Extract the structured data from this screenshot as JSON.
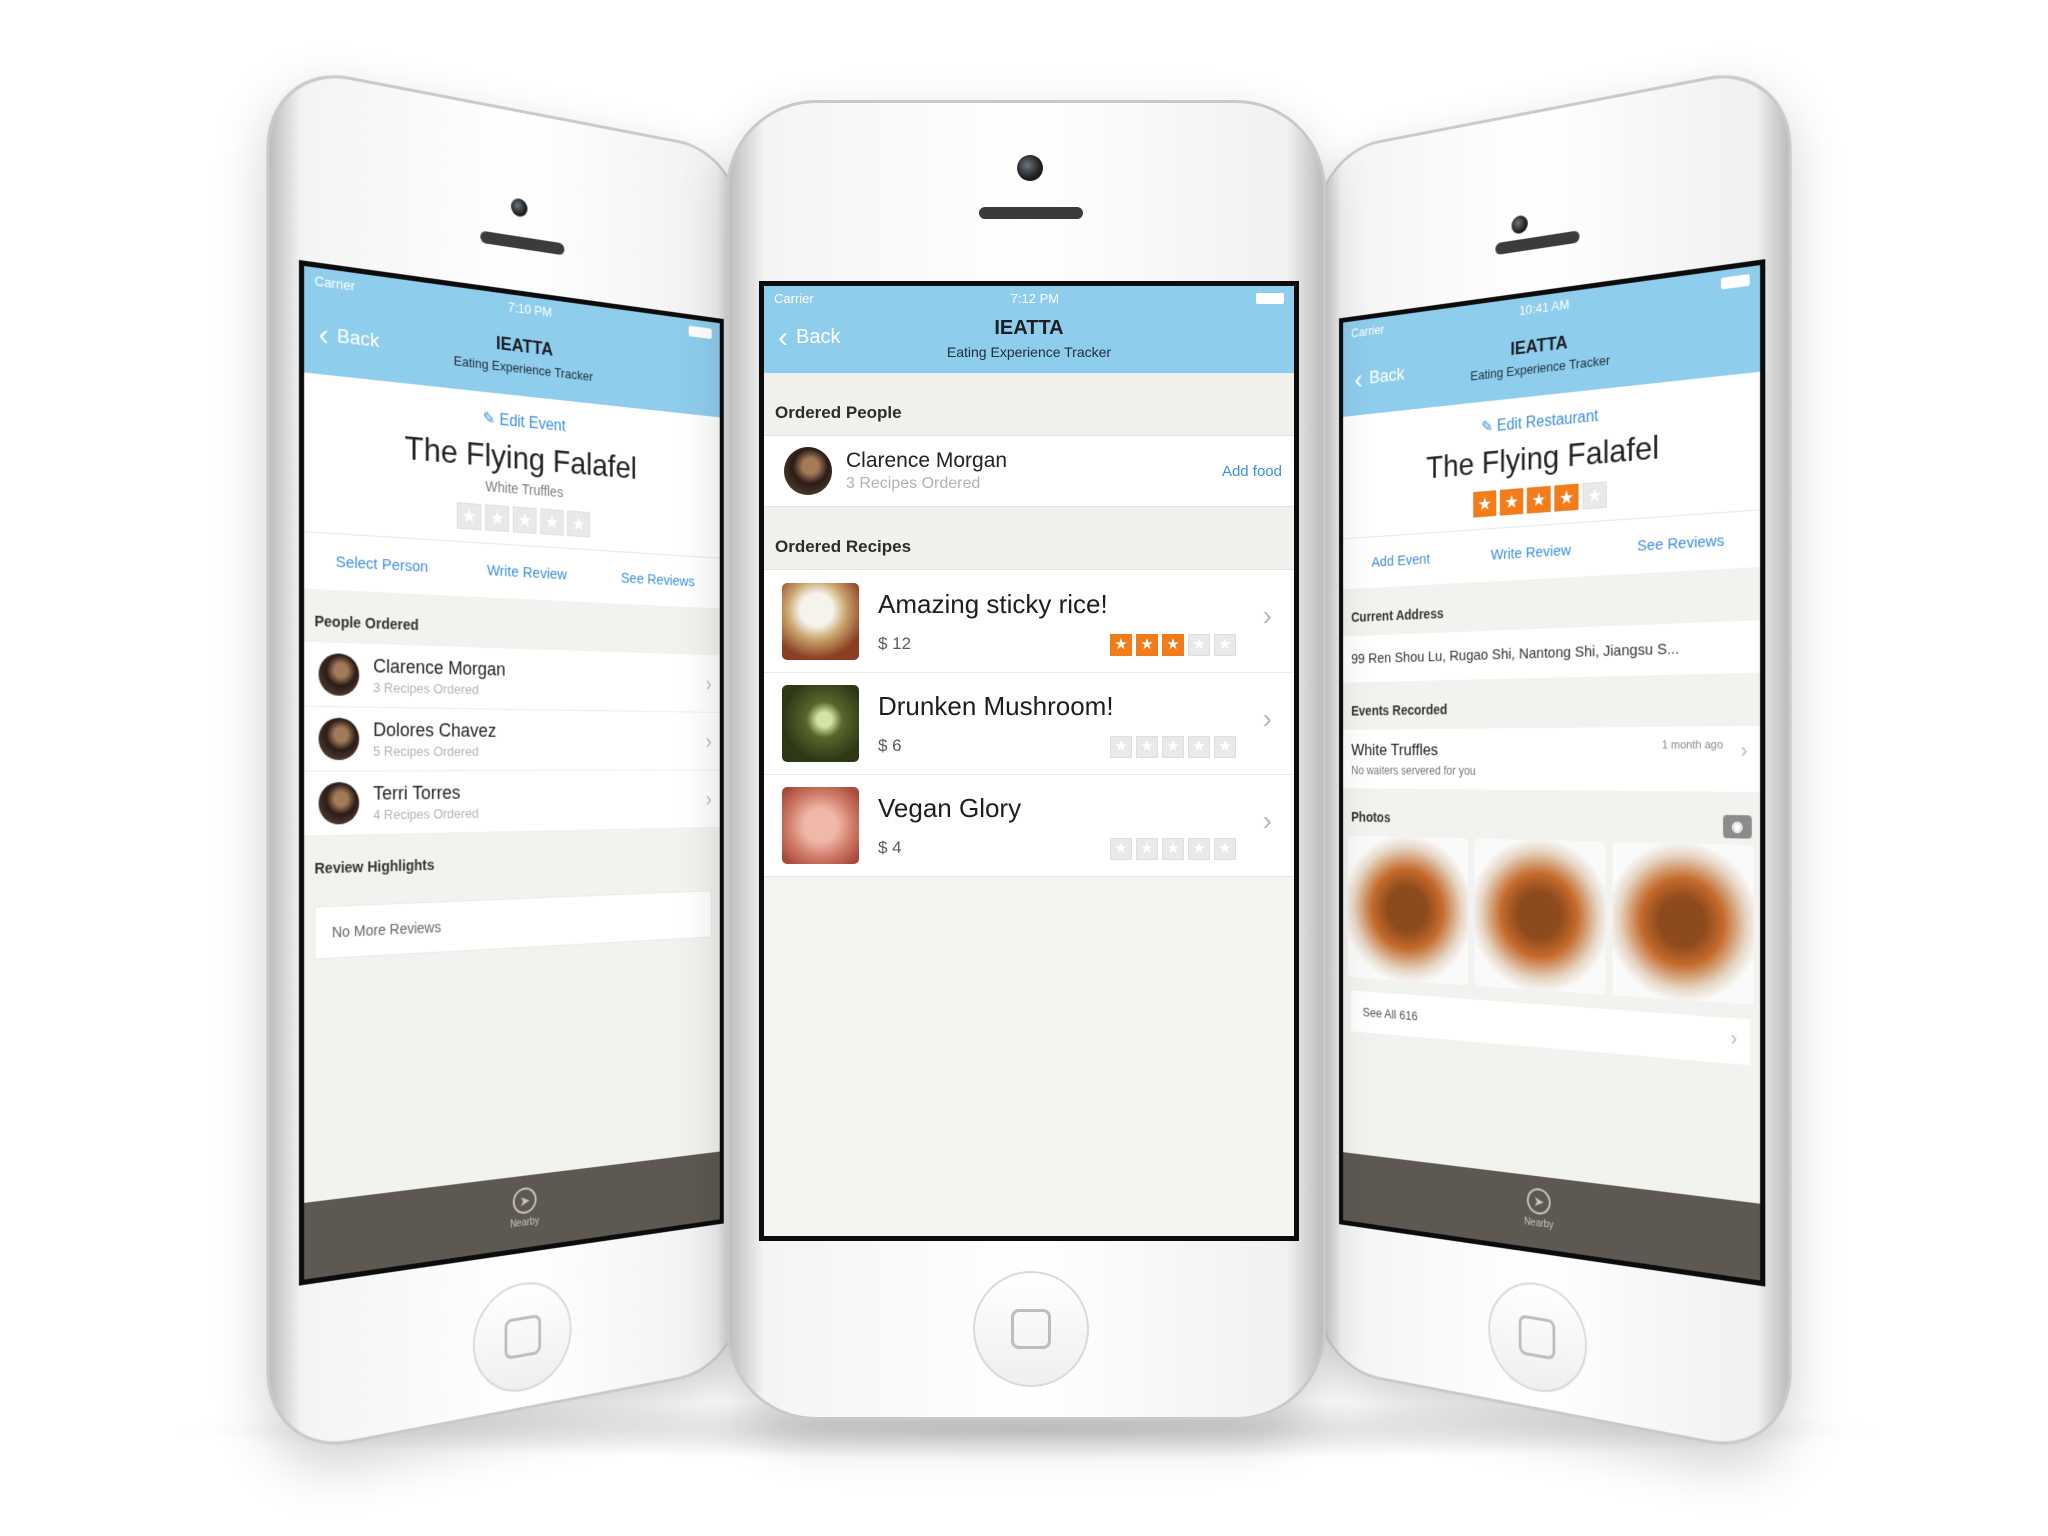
{
  "app": {
    "name": "IEATTA",
    "subtitle": "Eating Experience Tracker",
    "back_label": "Back",
    "colors": {
      "nav": "#8fcded",
      "accent": "#3e8fdf",
      "star_on": "#f27c1a",
      "tabbar": "#5e5853"
    }
  },
  "center": {
    "status": {
      "carrier": "Carrier",
      "time": "7:12 PM"
    },
    "ordered_people_label": "Ordered People",
    "person": {
      "name": "Clarence Morgan",
      "sub": "3 Recipes Ordered",
      "action": "Add food"
    },
    "ordered_recipes_label": "Ordered Recipes",
    "recipes": [
      {
        "title": "Amazing sticky rice!",
        "price": "$ 12",
        "rating": 3
      },
      {
        "title": "Drunken Mushroom!",
        "price": "$ 6",
        "rating": 0
      },
      {
        "title": "Vegan Glory",
        "price": "$ 4",
        "rating": 0
      }
    ]
  },
  "left": {
    "status": {
      "carrier": "Carrier",
      "time": "7:10 PM"
    },
    "edit": "Edit Event",
    "restaurant": "The Flying Falafel",
    "sub": "White Truffles",
    "rating": 0,
    "tabs": [
      "Select Person",
      "Write Review",
      "See Reviews"
    ],
    "people_label": "People Ordered",
    "people": [
      {
        "name": "Clarence Morgan",
        "sub": "3 Recipes Ordered"
      },
      {
        "name": "Dolores Chavez",
        "sub": "5 Recipes Ordered"
      },
      {
        "name": "Terri Torres",
        "sub": "4 Recipes Ordered"
      }
    ],
    "review_label": "Review Highlights",
    "no_reviews": "No More Reviews",
    "tabbar": "Nearby"
  },
  "right": {
    "status": {
      "carrier": "Carrier",
      "time": "10:41 AM"
    },
    "edit": "Edit Restaurant",
    "restaurant": "The Flying Falafel",
    "rating": 4,
    "tabs": [
      "Add Event",
      "Write Review",
      "See Reviews"
    ],
    "address_label": "Current Address",
    "address": "99 Ren Shou Lu, Rugao Shi, Nantong Shi, Jiangsu S...",
    "events_label": "Events Recorded",
    "event": {
      "title": "White Truffles",
      "sub": "No waiters servered for you",
      "ago": "1 month ago"
    },
    "photos_label": "Photos",
    "see_all": "See All 616",
    "tabbar": "Nearby"
  }
}
